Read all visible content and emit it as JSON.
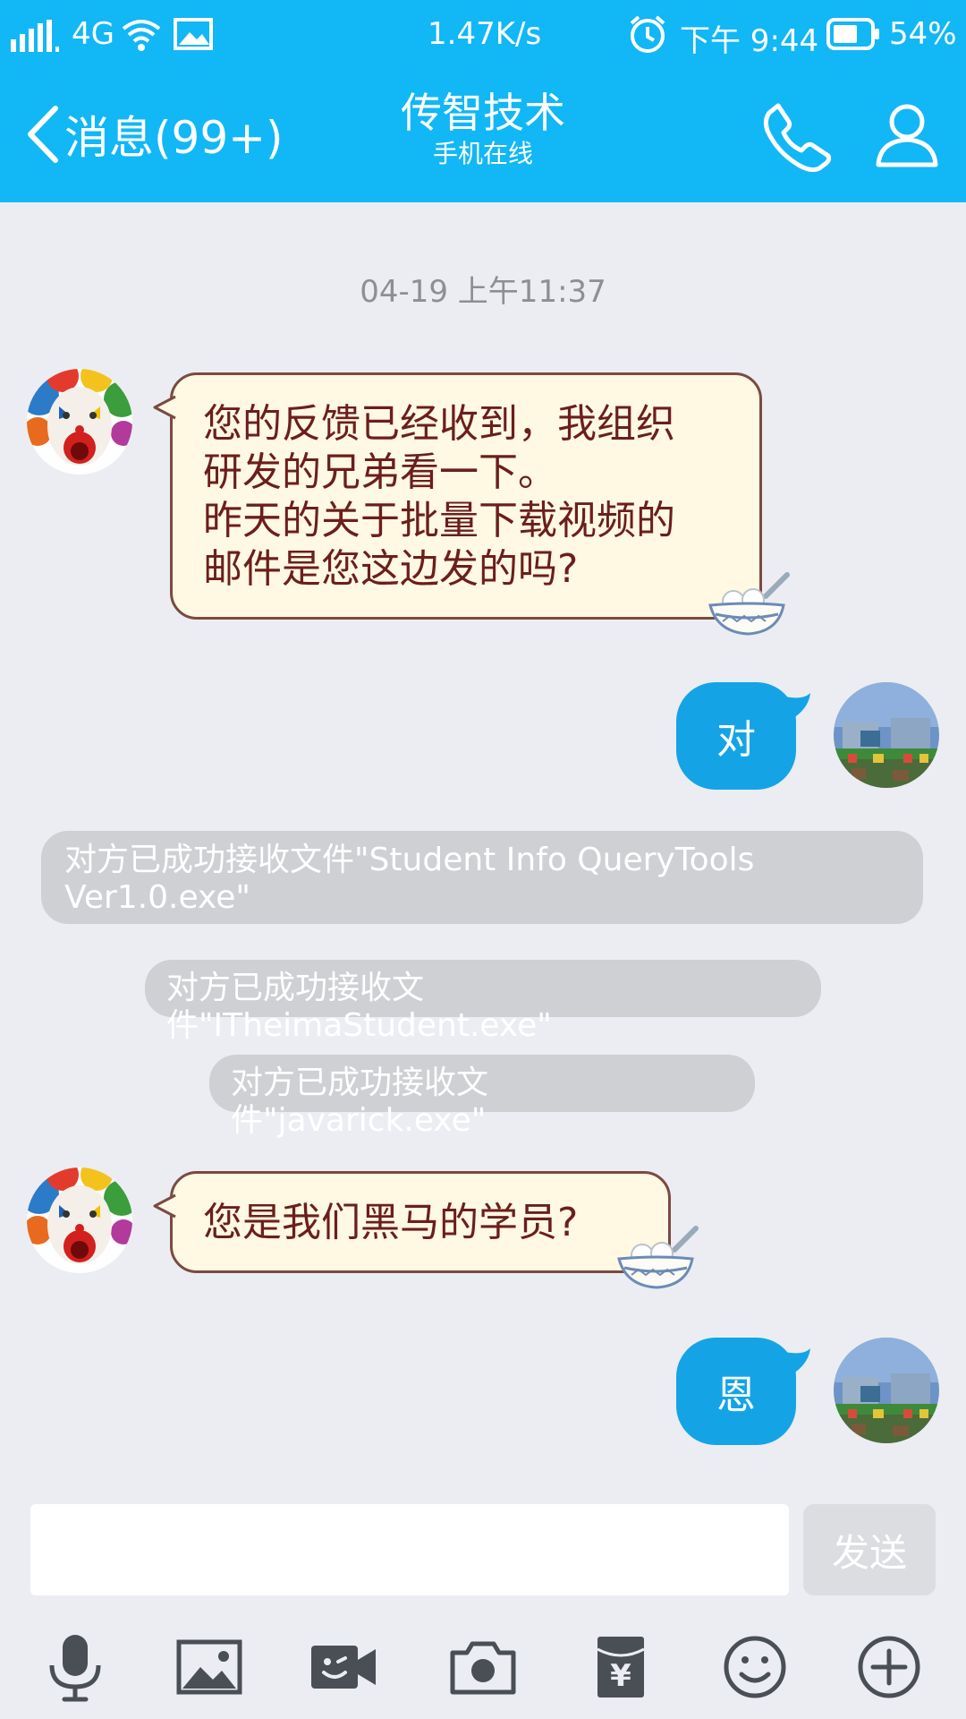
{
  "status_bar": {
    "network": "4G",
    "speed": "1.47K/s",
    "time": "下午 9:44",
    "battery": "54%",
    "icons": [
      "signal-icon",
      "wifi-icon",
      "picture-icon",
      "alarm-icon",
      "battery-icon"
    ]
  },
  "header": {
    "back_label": "消息(99+)",
    "title": "传智技术",
    "subtitle": "手机在线",
    "icons": [
      "phone-icon",
      "profile-icon"
    ]
  },
  "chat": {
    "timestamp": "04-19 上午11:37",
    "messages": [
      {
        "side": "in",
        "lines": [
          "您的反馈已经收到，我组织",
          "研发的兄弟看一下。",
          "昨天的关于批量下载视频的",
          "邮件是您这边发的吗?"
        ]
      },
      {
        "side": "out",
        "text": "对"
      },
      {
        "side": "system",
        "lines": [
          "对方已成功接收文件\"Student Info QueryTools",
          "Ver1.0.exe\""
        ]
      },
      {
        "side": "system",
        "text": "对方已成功接收文件\"ITheimaStudent.exe\""
      },
      {
        "side": "system",
        "text": "对方已成功接收文件\"javarick.exe\""
      },
      {
        "side": "in",
        "text": "您是我们黑马的学员?"
      },
      {
        "side": "out",
        "text": "恩"
      }
    ]
  },
  "input": {
    "value": "",
    "send_label": "发送"
  },
  "toolbar": {
    "icons": [
      "microphone-icon",
      "image-icon",
      "video-icon",
      "camera-icon",
      "red-packet-icon",
      "emoji-icon",
      "plus-icon"
    ],
    "red_packet_symbol": "¥"
  },
  "colors": {
    "accent": "#12b7f5",
    "outgoing_bubble": "#14a4e6",
    "incoming_bubble": "#fff8e3",
    "incoming_text": "#6b1f1a",
    "background": "#ebedf2"
  }
}
